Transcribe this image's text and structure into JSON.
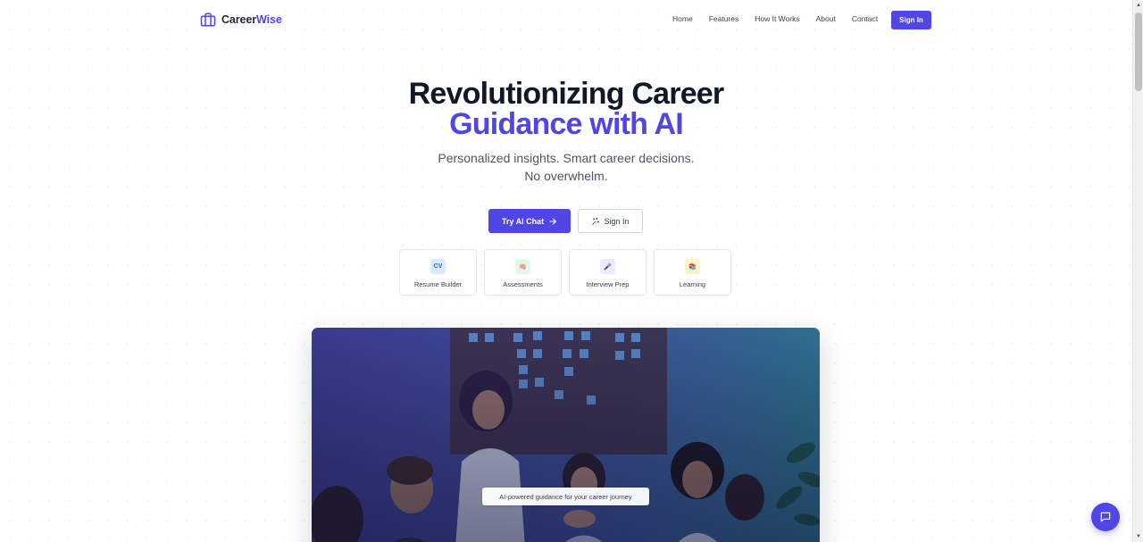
{
  "brand": {
    "name_part1": "Career",
    "name_part2": "Wise",
    "icon": "briefcase-icon"
  },
  "nav": {
    "links": [
      "Home",
      "Features",
      "How It Works",
      "About",
      "Contact"
    ],
    "signin_label": "Sign In"
  },
  "hero": {
    "title_line1": "Revolutionizing Career",
    "title_line2": "Guidance with AI",
    "subtitle_line1": "Personalized insights. Smart career decisions.",
    "subtitle_line2": "No overwhelm.",
    "primary_button": "Try AI Chat",
    "primary_button_icon": "arrow-right-icon",
    "secondary_button": "Sign In",
    "secondary_button_icon": "sparkles-icon"
  },
  "features": [
    {
      "label": "Resume Builder",
      "icon_text": "CV",
      "icon": "cv-icon",
      "bg": "#dbeafe",
      "fg": "#2563eb"
    },
    {
      "label": "Assessments",
      "icon_text": "🧠",
      "icon": "brain-icon",
      "bg": "#dcfce7",
      "fg": "#ec4899"
    },
    {
      "label": "Interview Prep",
      "icon_text": "🎤",
      "icon": "microphone-icon",
      "bg": "#ede9fe",
      "fg": "#7c3aed"
    },
    {
      "label": "Learning",
      "icon_text": "📚",
      "icon": "books-icon",
      "bg": "#fef3c7",
      "fg": "#b45309"
    }
  ],
  "image_caption": "AI-powered guidance for your career journey",
  "chat_fab_icon": "chat-icon",
  "colors": {
    "accent": "#4f46e5",
    "text": "#111827",
    "muted": "#4b5563"
  }
}
